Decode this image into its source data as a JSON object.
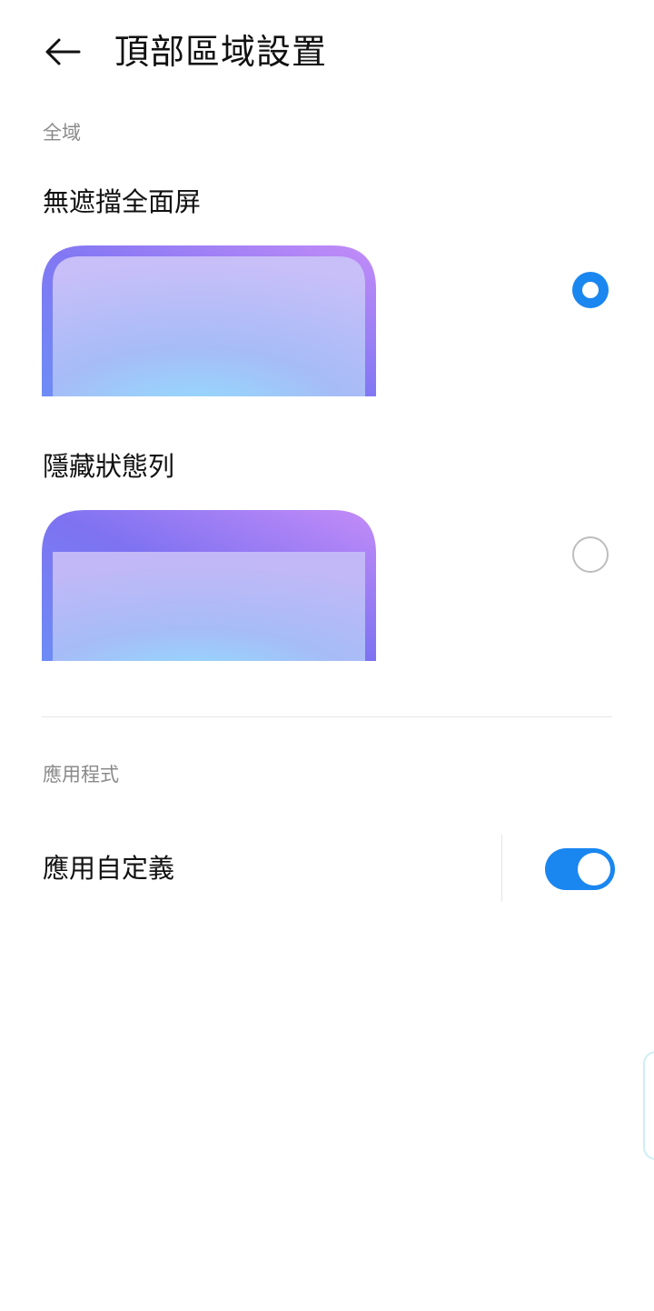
{
  "header": {
    "title": "頂部區域設置",
    "back_icon": "arrow-left-icon"
  },
  "sections": {
    "global": {
      "title": "全域",
      "options": [
        {
          "label": "無遮擋全面屏",
          "selected": true
        },
        {
          "label": "隱藏狀態列",
          "selected": false
        }
      ]
    },
    "apps": {
      "title": "應用程式",
      "custom_label": "應用自定義",
      "custom_enabled": true
    }
  },
  "colors": {
    "accent": "#1a86f0",
    "preview_frame": "#8a6ff0",
    "preview_light": "#94d6fd",
    "section_text": "#8a8a8a",
    "radio_off": "#bdbdbd"
  }
}
